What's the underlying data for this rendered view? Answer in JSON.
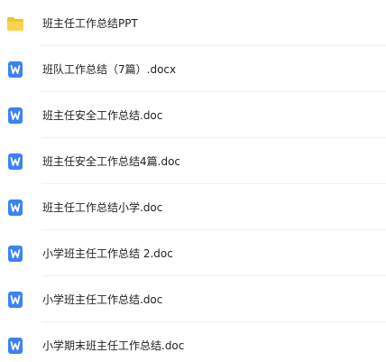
{
  "files": [
    {
      "name": "班主任工作总结PPT",
      "icon": "folder-icon",
      "color": "#f7c530"
    },
    {
      "name": "班队工作总结（7篇）.docx",
      "icon": "wps-word-icon",
      "color": "#3b82f6"
    },
    {
      "name": "班主任安全工作总结.doc",
      "icon": "wps-word-icon",
      "color": "#3b82f6"
    },
    {
      "name": "班主任安全工作总结4篇.doc",
      "icon": "wps-word-icon",
      "color": "#3b82f6"
    },
    {
      "name": "班主任工作总结小学.doc",
      "icon": "wps-word-icon",
      "color": "#3b82f6"
    },
    {
      "name": "小学班主任工作总结 2.doc",
      "icon": "wps-word-icon",
      "color": "#3b82f6"
    },
    {
      "name": "小学班主任工作总结.doc",
      "icon": "wps-word-icon",
      "color": "#3b82f6"
    },
    {
      "name": "小学期末班主任工作总结.doc",
      "icon": "wps-word-icon",
      "color": "#3b82f6"
    }
  ]
}
